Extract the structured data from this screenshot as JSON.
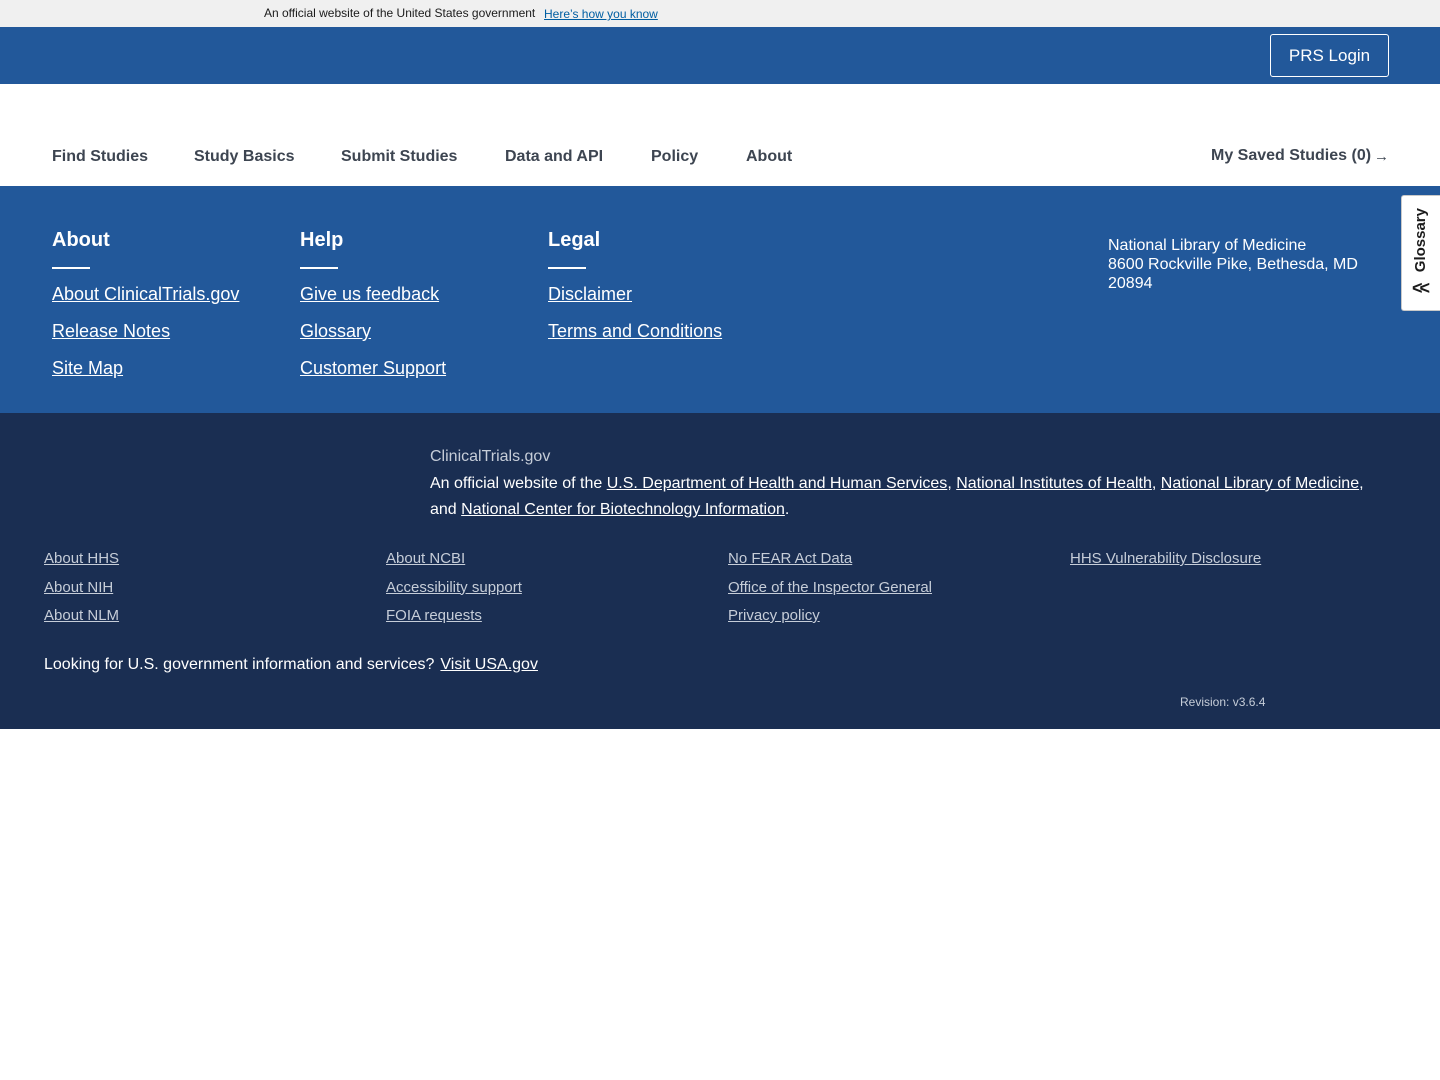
{
  "gov_banner": {
    "text": "An official website of the United States government",
    "link": "Here’s how you know"
  },
  "header": {
    "prs_login": "PRS Login"
  },
  "nav": {
    "items": [
      "Find Studies",
      "Study Basics",
      "Submit Studies",
      "Data and API",
      "Policy",
      "About"
    ],
    "saved_studies": "My Saved Studies (0)",
    "saved_arrow_icon": "arrow-right-icon"
  },
  "footer": {
    "about": {
      "heading": "About",
      "links": [
        "About ClinicalTrials.gov",
        "Release Notes",
        "Site Map"
      ]
    },
    "help": {
      "heading": "Help",
      "links": [
        "Give us feedback",
        "Glossary",
        "Customer Support"
      ]
    },
    "legal": {
      "heading": "Legal",
      "links": [
        "Disclaimer",
        "Terms and Conditions"
      ]
    },
    "address": {
      "line1": "National Library of Medicine",
      "line2": "8600 Rockville Pike, Bethesda, MD",
      "line3": "20894"
    }
  },
  "glossary_tab": {
    "label": "Glossary",
    "icon": "double-chevron-left-icon"
  },
  "footer_secondary": {
    "site_name": "ClinicalTrials.gov",
    "official_prefix": "An official website of the ",
    "hhs": "U.S. Department of Health and Human Services",
    "sep1": ", ",
    "nih": "National Institutes of Health",
    "sep2": ", ",
    "nlm": "National Library of Medicine",
    "sep3": ",",
    "and": "and ",
    "ncbi": "National Center for Biotechnology Information",
    "period": ".",
    "columns": [
      [
        "About HHS",
        "About NIH",
        "About NLM"
      ],
      [
        "About NCBI",
        "Accessibility support",
        "FOIA requests"
      ],
      [
        "No FEAR Act Data",
        "Office of the Inspector General",
        "Privacy policy"
      ],
      [
        "HHS Vulnerability Disclosure"
      ]
    ],
    "usa_text": "Looking for U.S. government information and services?",
    "usa_link": "Visit USA.gov",
    "revision": "Revision: v3.6.4"
  }
}
